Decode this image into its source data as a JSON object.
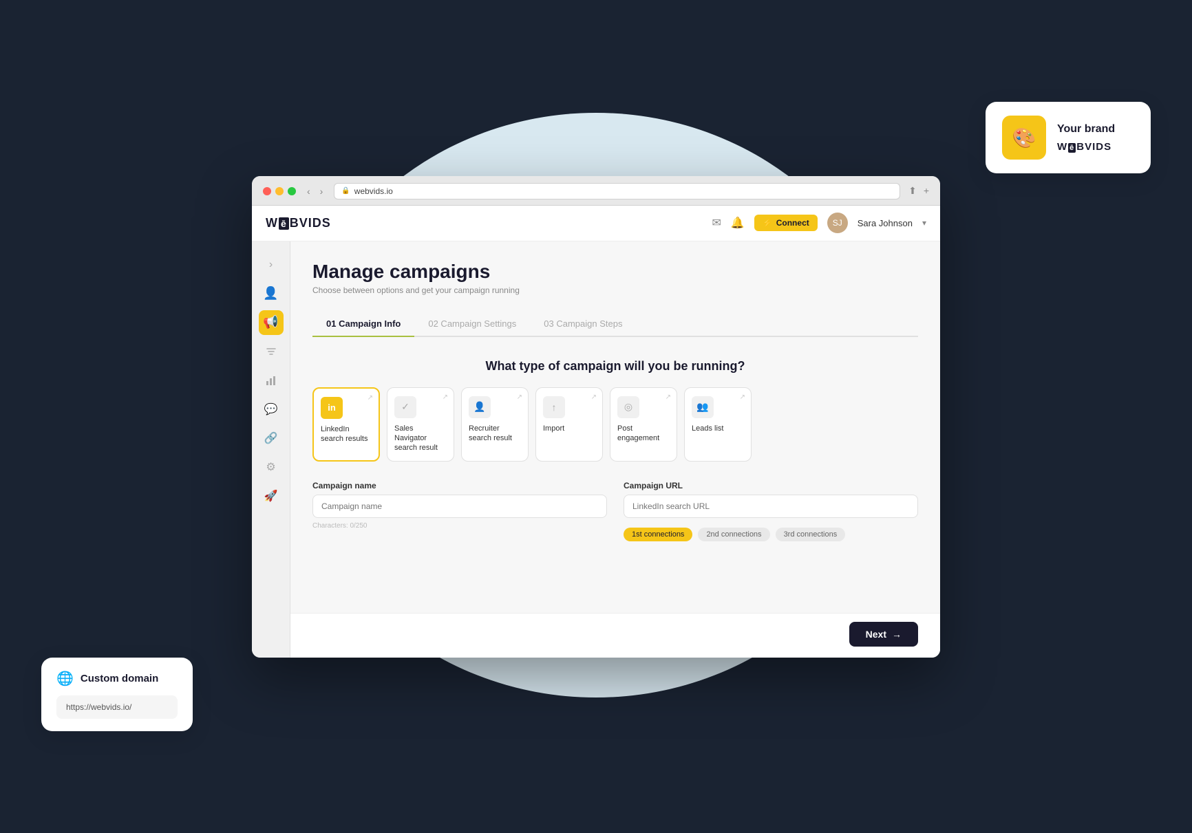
{
  "background": {
    "blob_color": "#d8e8f0"
  },
  "browser": {
    "url": "webvids.io",
    "dots": [
      "#ff5f57",
      "#ffbd2e",
      "#28c840"
    ]
  },
  "header": {
    "logo": "WēBVIDS",
    "connect_label": "Connect",
    "user_name": "Sara Johnson",
    "user_avatar_initials": "SJ"
  },
  "sidebar": {
    "items": [
      {
        "name": "toggle",
        "icon": "›",
        "active": false
      },
      {
        "name": "users",
        "icon": "👤",
        "active": false
      },
      {
        "name": "campaigns",
        "icon": "📢",
        "active": true
      },
      {
        "name": "filter",
        "icon": "▼",
        "active": false
      },
      {
        "name": "analytics",
        "icon": "📊",
        "active": false
      },
      {
        "name": "chat",
        "icon": "💬",
        "active": false
      },
      {
        "name": "links",
        "icon": "🔗",
        "active": false
      },
      {
        "name": "settings",
        "icon": "⚙",
        "active": false
      },
      {
        "name": "launch",
        "icon": "🚀",
        "active": false
      }
    ]
  },
  "page": {
    "title": "Manage campaigns",
    "subtitle": "Choose between options and get your campaign running"
  },
  "stepper": {
    "tabs": [
      {
        "id": "01",
        "label": "01 Campaign Info",
        "active": true
      },
      {
        "id": "02",
        "label": "02 Campaign Settings",
        "active": false
      },
      {
        "id": "03",
        "label": "03 Campaign Steps",
        "active": false
      }
    ]
  },
  "campaign_question": "What type of campaign will you be running?",
  "campaign_types": [
    {
      "id": "linkedin",
      "icon": "in",
      "label": "LinkedIn search results",
      "selected": true
    },
    {
      "id": "sales-nav",
      "icon": "✓",
      "label": "Sales Navigator search result",
      "selected": false
    },
    {
      "id": "recruiter",
      "icon": "👤",
      "label": "Recruiter search result",
      "selected": false
    },
    {
      "id": "import",
      "icon": "↑",
      "label": "Import",
      "selected": false
    },
    {
      "id": "post-engagement",
      "icon": "◎",
      "label": "Post engagement",
      "selected": false
    },
    {
      "id": "leads-list",
      "icon": "👥",
      "label": "Leads list",
      "selected": false
    }
  ],
  "form": {
    "campaign_name_label": "Campaign name",
    "campaign_name_placeholder": "Campaign name",
    "campaign_name_hint": "Characters: 0/250",
    "campaign_url_label": "Campaign URL",
    "campaign_url_placeholder": "LinkedIn search URL"
  },
  "connection_tags": [
    {
      "label": "1st connections",
      "active": true
    },
    {
      "label": "2nd connections",
      "active": false
    },
    {
      "label": "3rd connections",
      "active": false
    }
  ],
  "next_button": {
    "label": "Next",
    "arrow": "→"
  },
  "brand_card": {
    "title": "Your brand",
    "logo_text": "WēBVIDS"
  },
  "domain_card": {
    "title": "Custom domain",
    "icon": "🌐",
    "url": "https://webvids.io/"
  }
}
